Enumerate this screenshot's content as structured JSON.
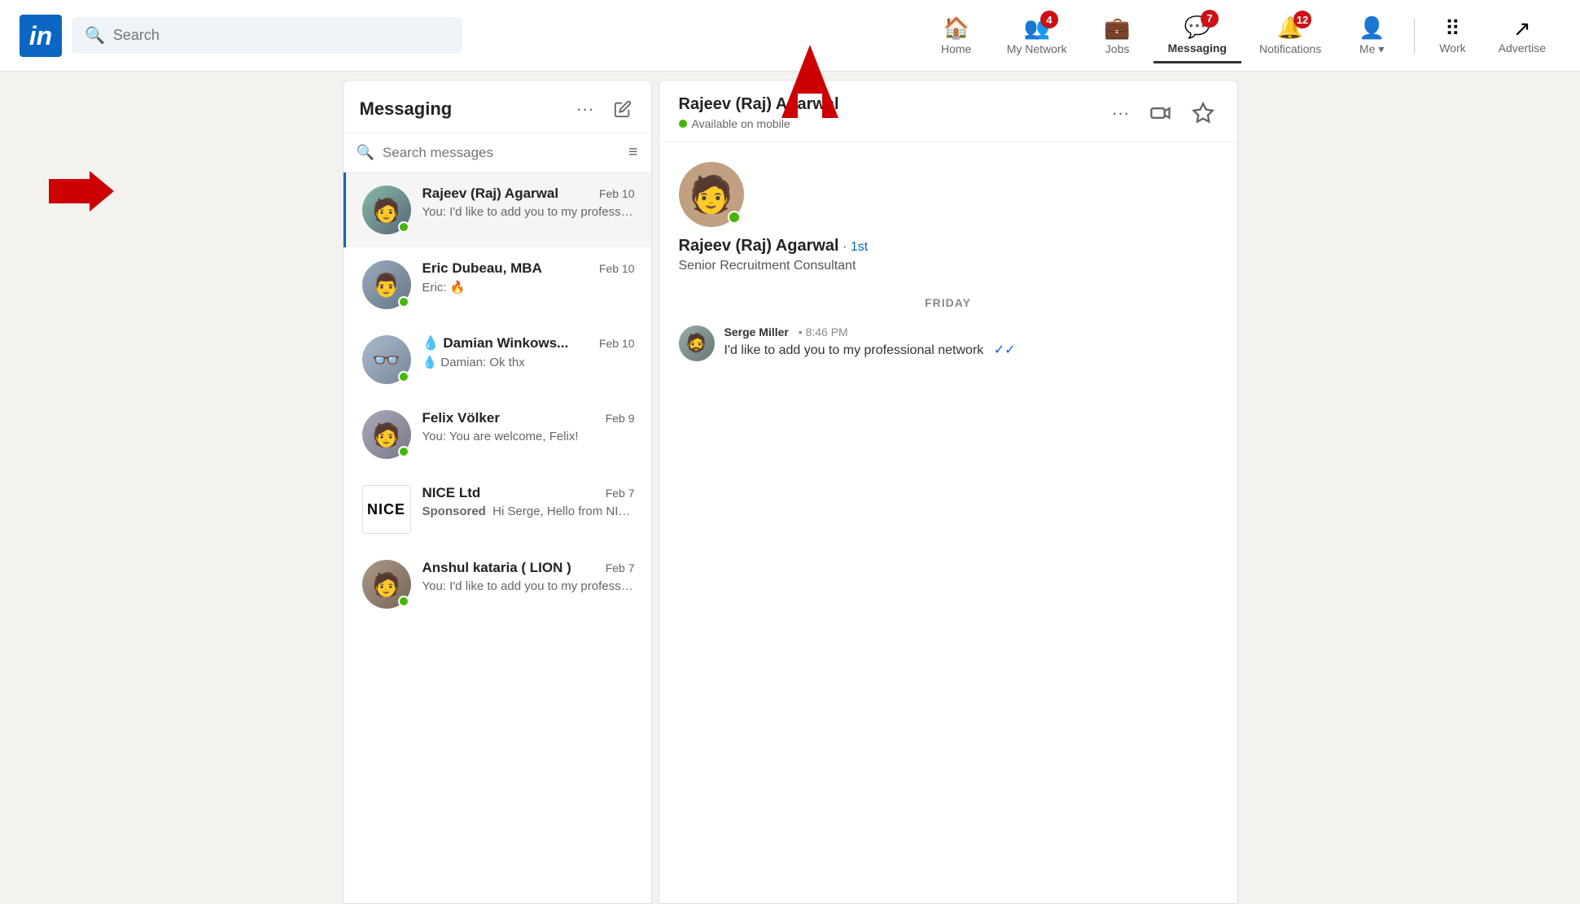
{
  "navbar": {
    "logo_text": "in",
    "search_placeholder": "Search",
    "nav_items": [
      {
        "id": "home",
        "label": "Home",
        "icon": "🏠",
        "badge": null,
        "active": false
      },
      {
        "id": "my-network",
        "label": "My Network",
        "icon": "👥",
        "badge": "4",
        "active": false
      },
      {
        "id": "jobs",
        "label": "Jobs",
        "icon": "💼",
        "badge": null,
        "active": false
      },
      {
        "id": "messaging",
        "label": "Messaging",
        "icon": "💬",
        "badge": "7",
        "active": true
      },
      {
        "id": "notifications",
        "label": "Notifications",
        "icon": "🔔",
        "badge": "12",
        "active": false
      },
      {
        "id": "me",
        "label": "Me ▾",
        "icon": "👤",
        "badge": null,
        "active": false
      }
    ],
    "work_label": "Work",
    "advertise_label": "Advertise"
  },
  "sidebar": {
    "title": "Messaging",
    "search_placeholder": "Search messages",
    "conversations": [
      {
        "id": "rajeev",
        "name": "Rajeev (Raj) Agarwal",
        "date": "Feb 10",
        "preview": "You: I'd like to add you to my professional network",
        "online": true,
        "active": true,
        "has_fire": false,
        "is_nice": false
      },
      {
        "id": "eric",
        "name": "Eric Dubeau, MBA",
        "date": "Feb 10",
        "preview": "Eric: 🔥",
        "online": true,
        "active": false,
        "has_fire": true,
        "is_nice": false
      },
      {
        "id": "damian",
        "name": "Damian Winkows...",
        "date": "Feb 10",
        "preview": "Damian: Ok thx",
        "online": true,
        "active": false,
        "has_fire": false,
        "has_droplet": true,
        "is_nice": false
      },
      {
        "id": "felix",
        "name": "Felix Völker",
        "date": "Feb 9",
        "preview": "You: You are welcome, Felix!",
        "online": true,
        "active": false,
        "has_fire": false,
        "is_nice": false
      },
      {
        "id": "nice",
        "name": "NICE Ltd",
        "date": "Feb 7",
        "preview": "Sponsored  Hi Serge, Hello from NICE. It's impossible ...",
        "online": false,
        "active": false,
        "has_fire": false,
        "is_nice": true
      },
      {
        "id": "anshul",
        "name": "Anshul kataria ( LION )",
        "date": "Feb 7",
        "preview": "You: I'd like to add you to my professional network",
        "online": true,
        "active": false,
        "has_fire": false,
        "is_nice": false
      }
    ]
  },
  "chat": {
    "header_name": "Rajeev (Raj) Agarwal",
    "status": "Available on mobile",
    "profile_name": "Rajeev (Raj) Agarwal",
    "profile_badge": "· 1st",
    "profile_title": "Senior Recruitment Consultant",
    "day_label": "FRIDAY",
    "messages": [
      {
        "sender": "Serge Miller",
        "time": "8:46 PM",
        "text": "I'd like to add you to my professional network",
        "read": true
      }
    ]
  }
}
